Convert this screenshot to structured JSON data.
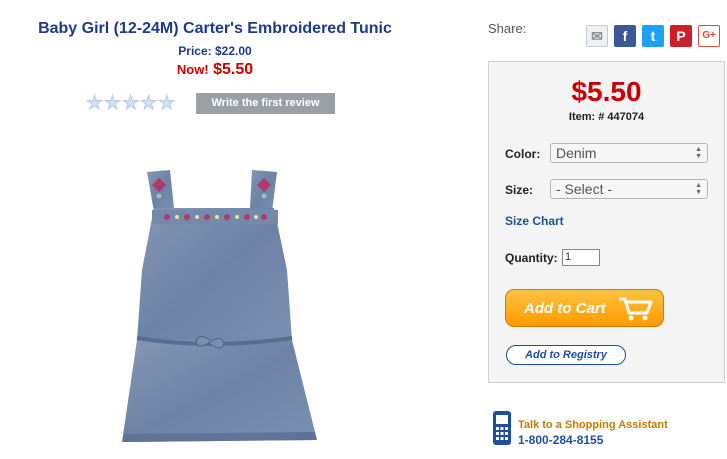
{
  "product": {
    "title": "Baby Girl (12-24M) Carter's Embroidered Tunic",
    "price_line": "Price: $22.00",
    "now_label": "Now!",
    "now_price": "$5.50",
    "rating_stars": 0,
    "review_button": "Write the first review"
  },
  "share": {
    "label": "Share:",
    "icons": [
      "email-icon",
      "facebook-icon",
      "twitter-icon",
      "pinterest-icon",
      "google-plus-icon"
    ]
  },
  "purchase": {
    "price": "$5.50",
    "item_number": "Item: # 447074",
    "color_label": "Color:",
    "color_value": "Denim",
    "size_label": "Size:",
    "size_value": "- Select -",
    "size_chart_link": "Size Chart",
    "quantity_label": "Quantity:",
    "quantity_value": "1",
    "add_to_cart": "Add to Cart",
    "add_to_registry": "Add to Registry"
  },
  "assistant": {
    "title": "Talk to a Shopping Assistant",
    "phone": "1-800-284-8155"
  },
  "colors": {
    "title_blue": "#1e3a8a",
    "price_red": "#cc0000",
    "cart_orange": "#ff9a00",
    "link_blue": "#1e4f9c"
  }
}
